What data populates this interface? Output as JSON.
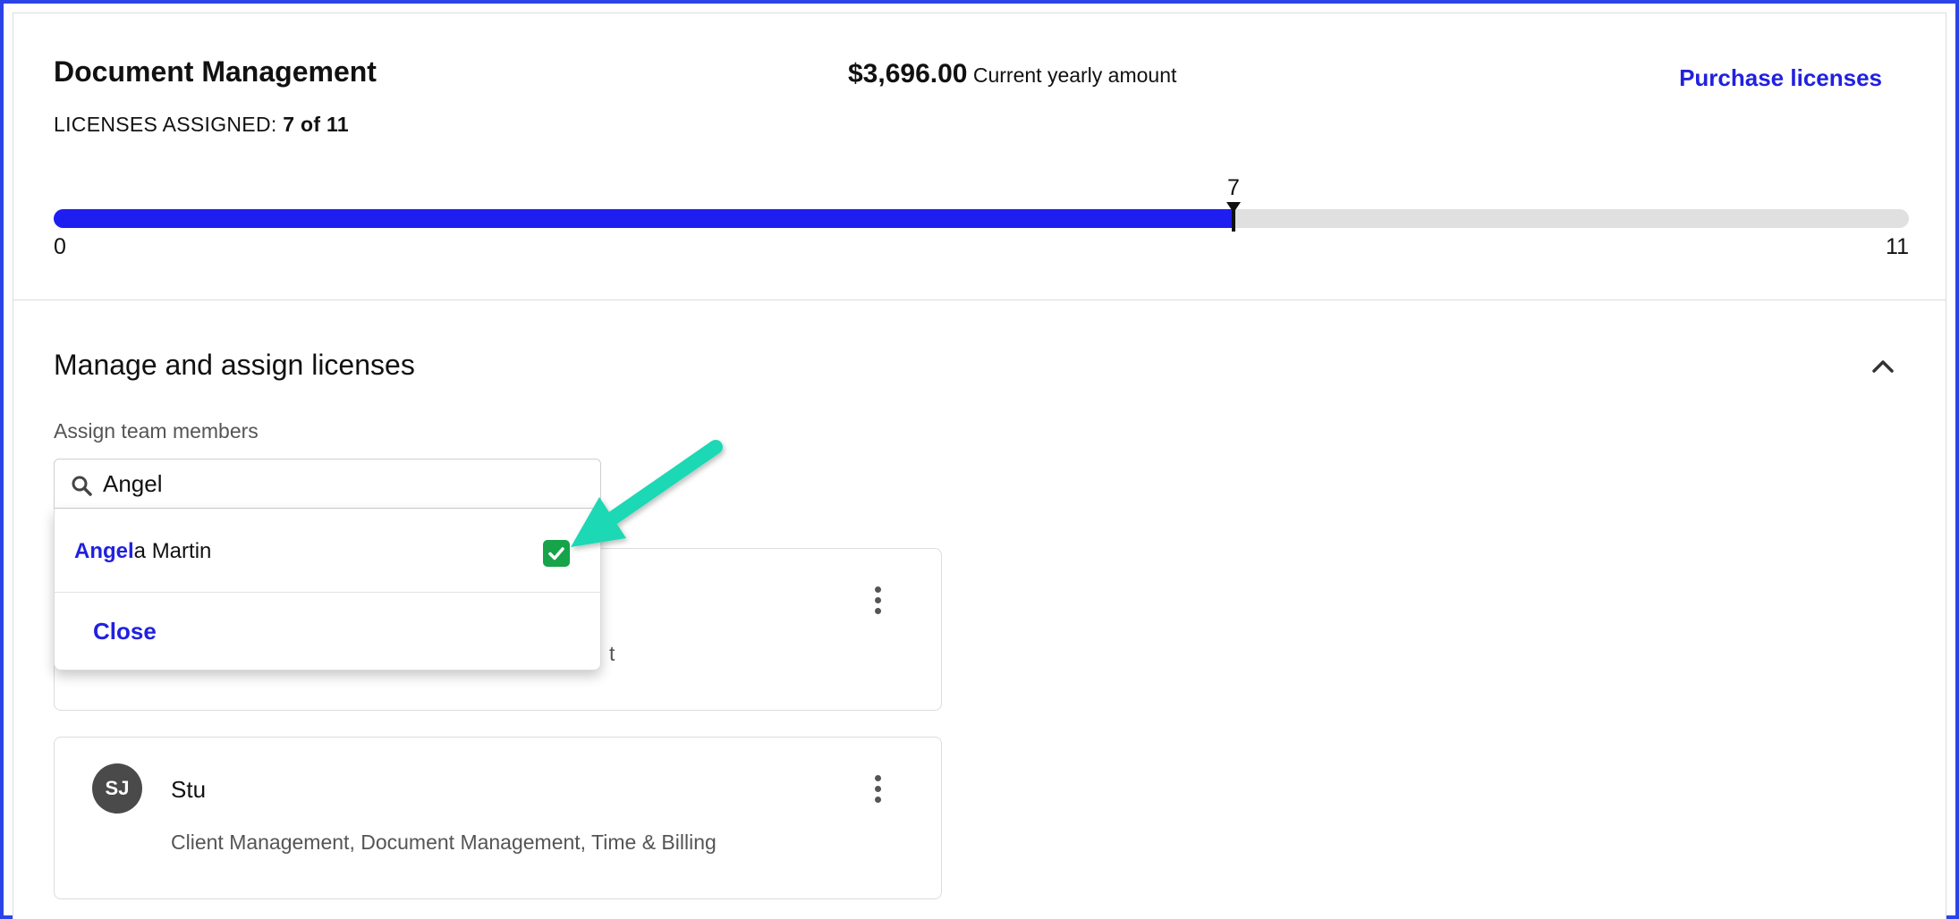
{
  "header": {
    "title": "Document Management",
    "licenses_label": "LICENSES ASSIGNED:",
    "licenses_value": "7 of 11",
    "amount": "$3,696.00",
    "amount_caption": "Current yearly amount",
    "purchase_label": "Purchase licenses"
  },
  "progress": {
    "min": "0",
    "max": "11",
    "current": "7",
    "fraction": 0.636
  },
  "manage": {
    "title": "Manage and assign licenses",
    "assign_label": "Assign team members",
    "search_value": "Angel"
  },
  "dropdown": {
    "option_match": "Angel",
    "option_rest": "a Martin",
    "option_checked": true,
    "close_label": "Close"
  },
  "cards": [
    {
      "initials": "",
      "name": "",
      "products": "t"
    },
    {
      "initials": "SJ",
      "name": "Stu",
      "products": "Client Management, Document Management, Time & Billing"
    }
  ],
  "colors": {
    "accent": "#2121e0",
    "progress_fill": "#1e1ef0",
    "check_green": "#17a34a",
    "callout_arrow": "#1fd8b4",
    "frame_border": "#2b44e6"
  },
  "icons": {
    "search": "search-icon",
    "collapse": "chevron-up-icon",
    "menu": "more-vertical-icon",
    "check": "check-icon",
    "annotation": "arrow-annotation-icon"
  }
}
